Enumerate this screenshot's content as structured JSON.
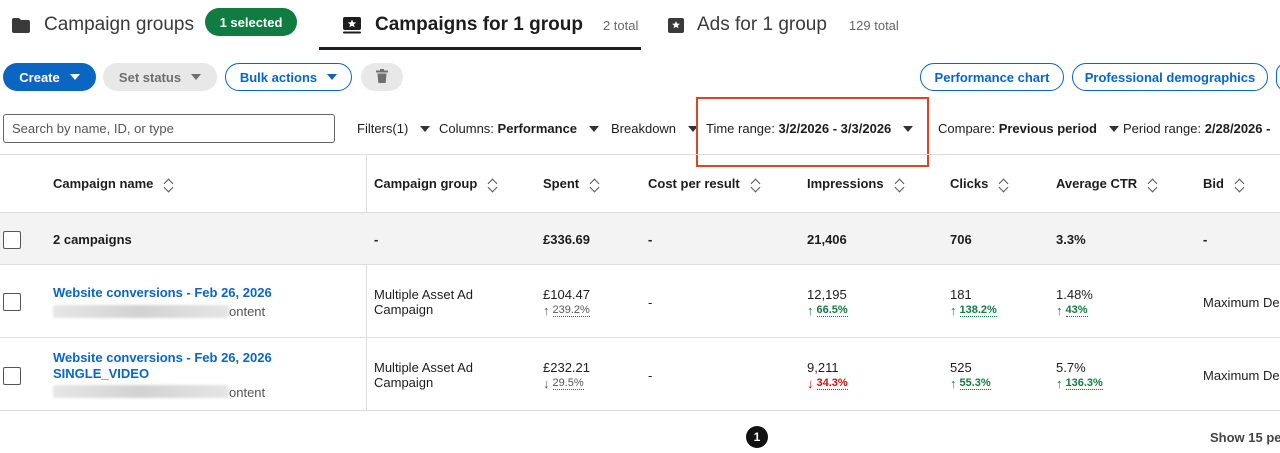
{
  "tabs": {
    "campaign_groups": {
      "label": "Campaign groups",
      "badge": "1 selected"
    },
    "campaigns": {
      "label": "Campaigns for 1 group",
      "count": "2 total"
    },
    "ads": {
      "label": "Ads for 1 group",
      "count": "129 total"
    }
  },
  "toolbar": {
    "create": "Create",
    "set_status": "Set status",
    "bulk_actions": "Bulk actions",
    "performance_chart": "Performance chart",
    "professional_demographics": "Professional demographics"
  },
  "filters": {
    "search_placeholder": "Search by name, ID, or type",
    "filters_label": "Filters(1)",
    "columns_label": "Columns:",
    "columns_value": "Performance",
    "breakdown_label": "Breakdown",
    "time_range_label": "Time range:",
    "time_range_value": "3/2/2026 - 3/3/2026",
    "compare_label": "Compare:",
    "compare_value": "Previous period",
    "period_range_label": "Period range:",
    "period_range_value": "2/28/2026 -"
  },
  "table": {
    "headers": {
      "campaign_name": "Campaign name",
      "campaign_group": "Campaign group",
      "spent": "Spent",
      "cost_per_result": "Cost per result",
      "impressions": "Impressions",
      "clicks": "Clicks",
      "average_ctr": "Average CTR",
      "bid": "Bid"
    },
    "summary": {
      "name": "2 campaigns",
      "group": "-",
      "spent": "£336.69",
      "cost_per_result": "-",
      "impressions": "21,406",
      "clicks": "706",
      "ctr": "3.3%",
      "bid": "-"
    },
    "rows": [
      {
        "name": "Website conversions - Feb 26, 2026",
        "name_line2": "",
        "sub_suffix": "ontent",
        "group": "Multiple Asset Ad",
        "group_line2": "Campaign",
        "spent": "£104.47",
        "spent_delta": "239.2%",
        "cost_per_result": "-",
        "impressions": "12,195",
        "impressions_delta": "66.5%",
        "clicks": "181",
        "clicks_delta": "138.2%",
        "ctr": "1.48%",
        "ctr_delta": "43%",
        "bid": "Maximum Del"
      },
      {
        "name": "Website conversions - Feb 26, 2026",
        "name_line2": "SINGLE_VIDEO",
        "sub_suffix": "ontent",
        "group": "Multiple Asset Ad",
        "group_line2": "Campaign",
        "spent": "£232.21",
        "spent_delta": "29.5%",
        "cost_per_result": "-",
        "impressions": "9,211",
        "impressions_delta": "34.3%",
        "clicks": "525",
        "clicks_delta": "55.3%",
        "ctr": "5.7%",
        "ctr_delta": "136.3%",
        "bid": "Maximum Del"
      }
    ]
  },
  "pagination": {
    "current_page": "1",
    "page_size_label": "Show 15 pe"
  },
  "colors": {
    "primary": "#0a66c2",
    "success": "#107c41",
    "danger": "#cc1016",
    "highlight": "#d9472b"
  },
  "icons": {
    "folder": "folder-icon",
    "campaign": "campaign-icon",
    "ad": "ad-icon",
    "trash": "trash-icon"
  }
}
